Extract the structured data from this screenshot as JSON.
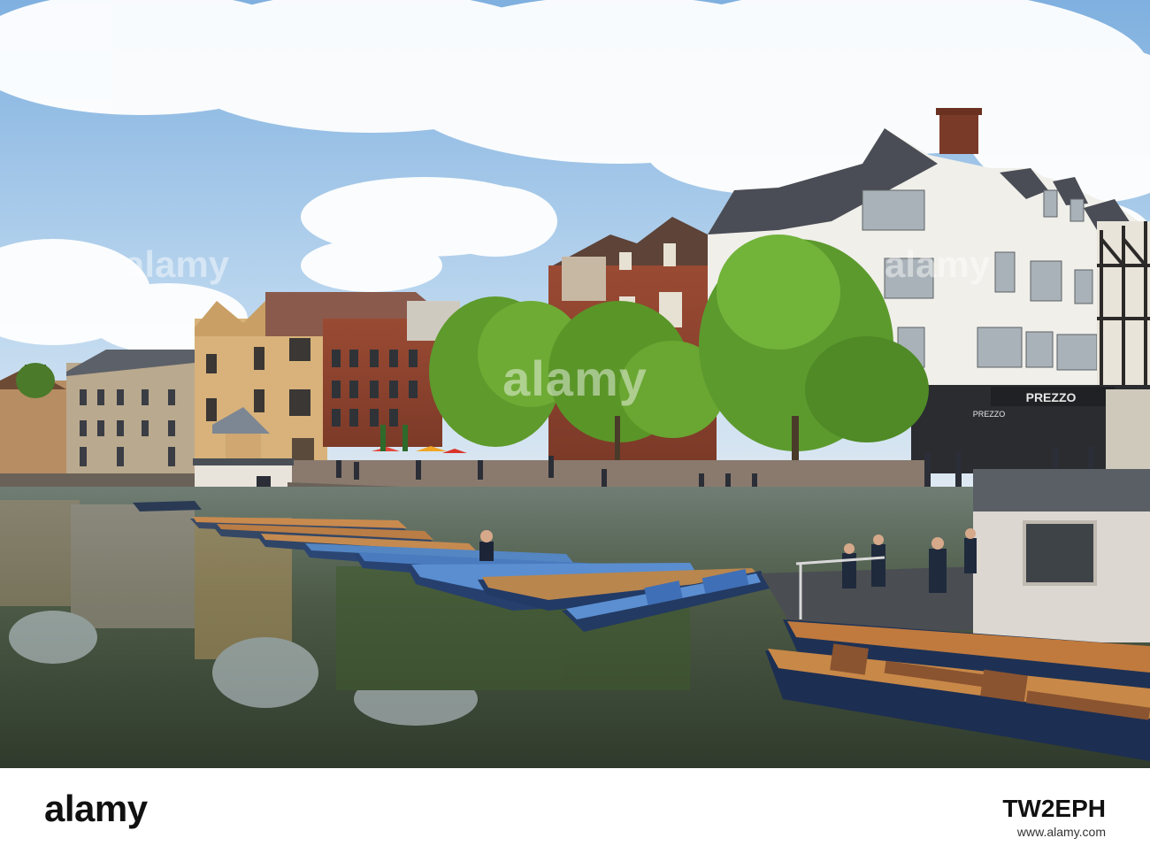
{
  "photo": {
    "watermark_main": "alamy",
    "watermark_side": "alamy",
    "shop_sign": "PREZZO",
    "shop_sign_small": "PREZZO"
  },
  "footer": {
    "logo": "alamy",
    "image_id": "TW2EPH",
    "url": "www.alamy.com"
  },
  "colors": {
    "sky": "#9cc3e6",
    "water": "#4f5a4a",
    "tree": "#5c9a2e",
    "punt_blue": "#2a4f86",
    "punt_wood": "#c98a4e"
  }
}
